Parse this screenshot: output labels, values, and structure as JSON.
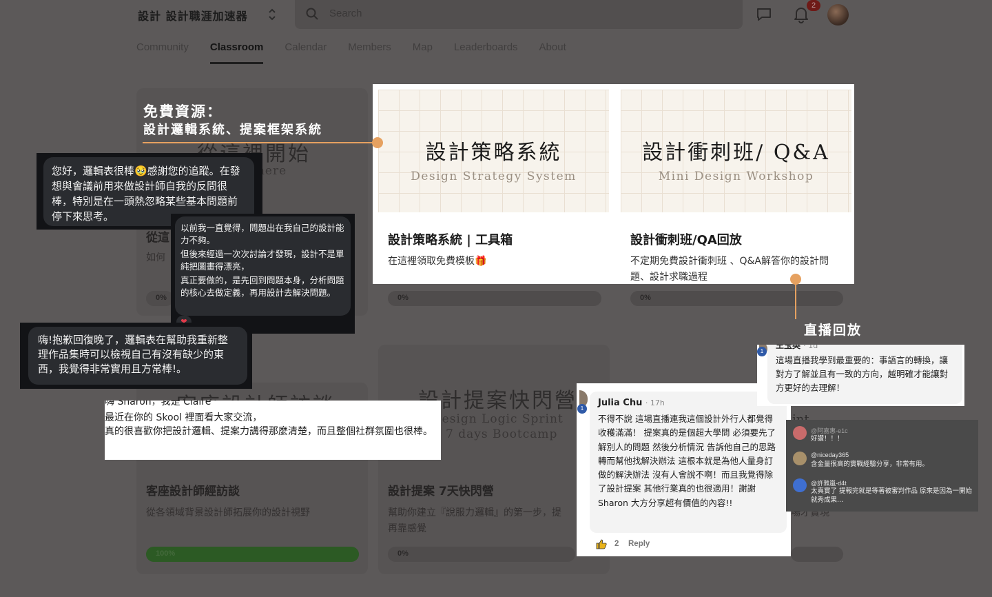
{
  "topbar": {
    "group_title": "設計  設計職涯加速器",
    "search_placeholder": "Search",
    "notification_count": "2"
  },
  "tabs": [
    {
      "label": "Community"
    },
    {
      "label": "Classroom",
      "active": true
    },
    {
      "label": "Calendar"
    },
    {
      "label": "Members"
    },
    {
      "label": "Map"
    },
    {
      "label": "Leaderboards"
    },
    {
      "label": "About"
    }
  ],
  "annotations": {
    "free_resources_line1": "免費資源：",
    "free_resources_line2": "設計邏輯系統、提案框架系統",
    "live_replay": "直播回放"
  },
  "courses": {
    "strategy": {
      "image_title": "設計策略系統",
      "image_subtitle": "Design Strategy System",
      "title": "設計策略系統 | 工具箱",
      "description": "在這裡領取免費模板🎁",
      "progress": "0%"
    },
    "sprint_qa": {
      "image_title": "設計衝刺班/ Q&A",
      "image_subtitle": "Mini Design Workshop",
      "title": "設計衝刺班/QA回放",
      "description": "不定期免費設計衝刺班 、Q&A解答你的設計問題、設計求職過程",
      "progress": "0%"
    },
    "start_here": {
      "image_title": "從這裡開始",
      "image_subtitle": "Start here",
      "title": "從這",
      "description": "如何",
      "progress": "0%"
    },
    "interviews": {
      "image_title": "客座設計師訪談",
      "title": "客座設計師經訪談",
      "description": "從各領域背景設計師拓展你的設計視野",
      "progress": "100%",
      "progress_value": 1.0
    },
    "bootcamp": {
      "image_title": "設計提案快閃營",
      "image_subtitle": "Design Logic Sprint",
      "image_subtitle2": "7 days Bootcamp",
      "title": "設計提案 7天快閃營",
      "description_line1": "幫助你建立『說服力邏輯』的第一步，提",
      "description_line2": "再靠感覺",
      "progress": "0%"
    },
    "fourth": {
      "progress": "0%",
      "fragment": "int",
      "desc_fragment": "場才實現"
    }
  },
  "dark_bubbles": {
    "bubble1": "您好，邏輯表很棒🥹感謝您的追蹤。在發想與會議前用來做設計師自我的反問很棒，特別是在一頭熱忽略某些基本問題前停下來思考。",
    "bubble2_p1": "以前我一直覺得，問題出在我自己的設計能力不夠。",
    "bubble2_p2": "但後來經過一次次討論才發現，設計不是單純把圖畫得漂亮，",
    "bubble2_p3": "真正要做的，是先回到問題本身，分析問題的核心去做定義，再用設計去解決問題。",
    "bubble3": "嗨!抱歉回復晚了，邏輯表在幫助我重新整理作品集時可以檢視自己有沒有缺少的東西，我覺得非常實用且方常棒!。"
  },
  "testimonials": {
    "skool_header": "嗨 Sharon，我是 Claire",
    "skool_line1": "最近在你的 Skool 裡面看大家交流，",
    "skool_line2": "真的很喜歡你把設計邏輯、提案力講得那麼清楚，而且整個社群氛圍也很棒。",
    "julia_name": "Julia Chu",
    "julia_time": "· 17h",
    "julia_comment": "不得不說 這場直播連我這個設計外行人都覺得收穫滿滿！ 提案真的是個超大學問 必須要先了解別人的問題 然後分析情況 告訴他自己的思路 轉而幫他找解決辦法 這根本就是為他人量身訂做的解決辦法 沒有人會說不啊！而且我覺得除了設計提案 其他行業真的也很適用！謝謝Sharon 大方分享超有價值的內容!!",
    "julia_likes": "2",
    "julia_reply": "Reply",
    "level": "1",
    "top_name": "王玉英",
    "top_time": "· 1d",
    "top_comment": "這場直播我學到最重要的：事語言的轉換，讓對方了解並且有一致的方向，越明確才能讓對方更好的去理解！"
  },
  "live_chat": [
    {
      "name": "@阿嘉惠-e1c",
      "message": "好讚！！！"
    },
    {
      "name": "@niceday365",
      "message": "含金量很高的實戰經驗分享，非常有用。"
    },
    {
      "name": "@許雅嵐-d4t",
      "message": "太真實了 提報完就是等著被審判作品 原來是因為一開始就秀成果..."
    }
  ],
  "colors": {
    "accent_orange": "#e6a160",
    "progress_green": "#2c5a24",
    "level_badge_blue": "#2f5aa8",
    "dimmed_background": "#5c5959"
  }
}
